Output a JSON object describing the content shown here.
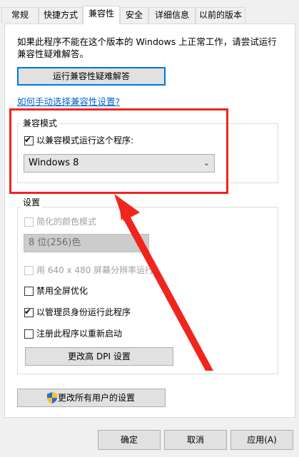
{
  "tabs": [
    "常规",
    "快捷方式",
    "兼容性",
    "安全",
    "详细信息",
    "以前的版本"
  ],
  "active_tab": "兼容性",
  "intro_text": "如果此程序不能在这个版本的 Windows 上正常工作，请尝试运行兼容性疑难解答。",
  "troubleshooter_button": "运行兼容性疑难解答",
  "manual_link": "如何手动选择兼容性设置?",
  "compat_mode": {
    "title": "兼容模式",
    "checkbox_label": "以兼容模式运行这个程序:",
    "checked": true,
    "selected_os": "Windows 8"
  },
  "settings": {
    "title": "设置",
    "reduced_color": {
      "label": "简化的颜色模式",
      "checked": false,
      "disabled": true
    },
    "color_select": "8 位(256)色",
    "res_640": {
      "label": "用 640 x 480 屏幕分辨率运行",
      "checked": false,
      "disabled": true
    },
    "disable_fullscreen": {
      "label": "禁用全屏优化",
      "checked": false
    },
    "run_as_admin": {
      "label": "以管理员身份运行此程序",
      "checked": true
    },
    "register_restart": {
      "label": "注册此程序以重新启动",
      "checked": false
    },
    "dpi_button": "更改高 DPI 设置"
  },
  "all_users_button": "更改所有用户的设置",
  "footer": {
    "ok": "确定",
    "cancel": "取消",
    "apply": "应用(A)"
  },
  "annotation_color": "#f0251d"
}
